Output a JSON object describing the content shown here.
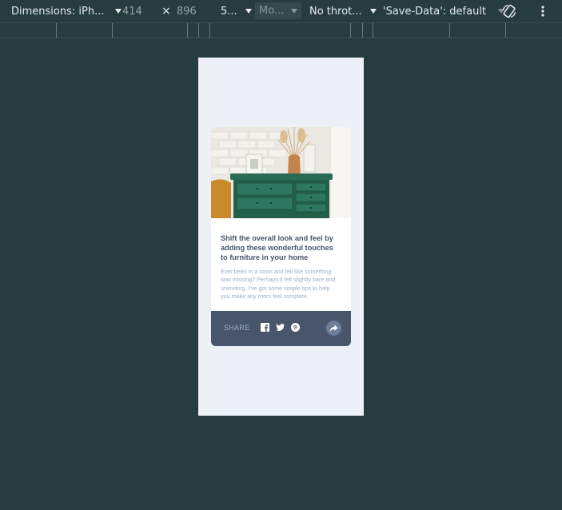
{
  "toolbar": {
    "device_label": "Dimensions: iPh...",
    "width_value": "414",
    "times_symbol": "×",
    "height_value": "896",
    "zoom_label": "5...",
    "mode_label": "Mo...",
    "throttle_label": "No throt...",
    "save_data_label": "'Save-Data': default"
  },
  "card": {
    "title": "Shift the overall look and feel by adding these wonderful touches to furniture in your home",
    "description": "Ever been in a room and felt like something was missing? Perhaps it felt slightly bare and uninviting. I’ve got some simple tips to help you make any room feel complete.",
    "share_label": "SHARE"
  },
  "icons": [
    "facebook-icon",
    "twitter-icon",
    "pinterest-icon",
    "share-arrow-icon",
    "rotate-icon",
    "more-vert-icon"
  ],
  "colors": {
    "devtools_bg": "#263c40",
    "page_bg": "#edf1f7",
    "share_bar": "#48556a",
    "share_btn": "#6d7f97",
    "title_text": "#48556a",
    "muted_text": "#9eafc2"
  }
}
